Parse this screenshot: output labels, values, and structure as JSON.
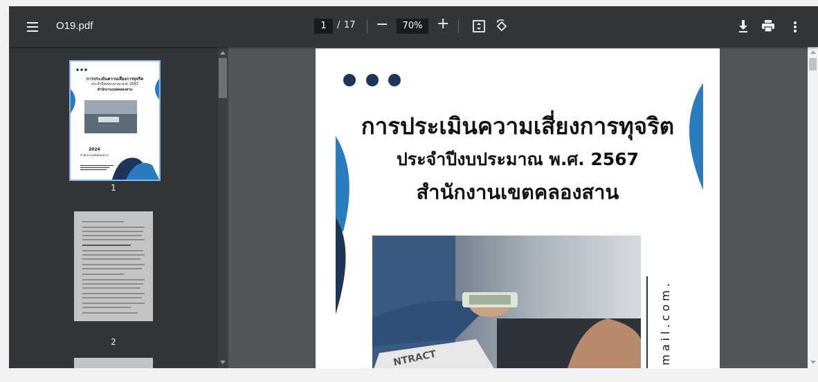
{
  "toolbar": {
    "filename": "O19.pdf",
    "current_page": "1",
    "page_separator": "/",
    "total_pages": "17",
    "zoom": "70%",
    "zoom_out_label": "−",
    "zoom_in_label": "+"
  },
  "sidebar": {
    "thumbnails": [
      {
        "label": "1",
        "selected": true
      },
      {
        "label": "2",
        "selected": false
      }
    ]
  },
  "document": {
    "title_line1": "การประเมินความเสี่ยงการทุจริต",
    "title_line2": "ประจำปีงบประมาณ พ.ศ. 2567",
    "title_line3": "สำนักงานเขตคลองสาน",
    "side_email": "gmail.com.",
    "photo_contract_text": "NTRACT"
  },
  "thumb1": {
    "title_line1": "การประเมินความเสี่ยงการทุจริต",
    "title_line2": "ประจำปีงบประมาณ พ.ศ. 2567",
    "title_line3": "สำนักงานเขตคลองสาน",
    "year": "2024",
    "office": "สำนักงานเขตคลองสาน"
  },
  "colors": {
    "toolbar_bg": "#323639",
    "viewer_bg": "#525659",
    "selection_border": "#8ab4f8",
    "accent_blue": "#2b7bc0",
    "navy": "#1d3557"
  }
}
